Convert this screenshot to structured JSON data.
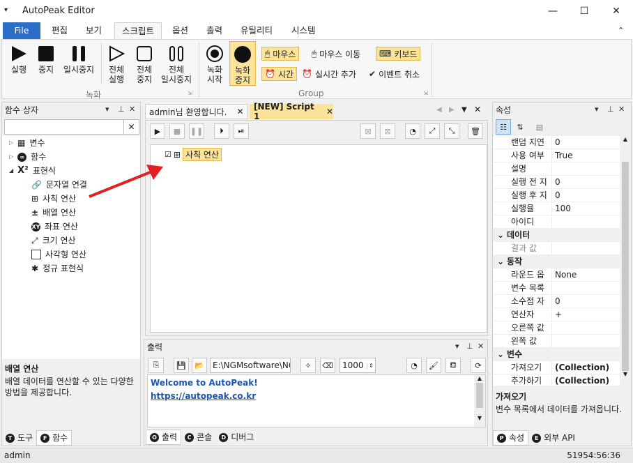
{
  "window": {
    "title": "AutoPeak Editor",
    "minimize": "—",
    "maximize": "☐",
    "close": "✕"
  },
  "ribbon_tabs": [
    "File",
    "편집",
    "보기",
    "스크립트",
    "옵션",
    "출력",
    "유틸리티",
    "시스템"
  ],
  "ribbon": {
    "run": "실행",
    "stop": "중지",
    "pause": "일시중지",
    "all_run": [
      "전체",
      "실행"
    ],
    "all_stop": [
      "전체",
      "중지"
    ],
    "all_pause": [
      "전체",
      "일시중지"
    ],
    "group1_label": "녹화",
    "rec_start": [
      "녹화",
      "시작"
    ],
    "rec_stop": [
      "녹화",
      "중지"
    ],
    "mouse": "마우스",
    "mouse_move": "마우스 이동",
    "keyboard": "키보드",
    "time": "시간",
    "realtime_add": "실시간 추가",
    "event_cancel": "이벤트 취소",
    "group2_label": "Group"
  },
  "func_panel": {
    "title": "함수 상자",
    "search_placeholder": "",
    "tree": [
      {
        "label": "변수",
        "icon": "variable-icon"
      },
      {
        "label": "함수",
        "icon": "function-icon"
      },
      {
        "label": "표현식",
        "icon": "expression-icon"
      }
    ],
    "children": [
      {
        "label": "문자열 연결",
        "icon": "link-icon"
      },
      {
        "label": "사칙 연산",
        "icon": "arithmetic-icon"
      },
      {
        "label": "배열 연산",
        "icon": "plusminus-icon"
      },
      {
        "label": "좌표 연산",
        "icon": "xy-icon"
      },
      {
        "label": "크기 연산",
        "icon": "resize-icon"
      },
      {
        "label": "사각형 연산",
        "icon": "rectangle-icon"
      },
      {
        "label": "정규 표현식",
        "icon": "asterisk-icon"
      }
    ],
    "desc_title": "배열 연산",
    "desc_text": "배열 데이터를 연산할 수 있는 다양한 방법을 제공합니다.",
    "tabs": [
      "도구",
      "함수"
    ]
  },
  "editor": {
    "tabs": [
      "admin님 환영합니다.",
      "[NEW] Script 1"
    ],
    "node_label": "사칙 연산"
  },
  "output": {
    "title": "출력",
    "path": "E:\\NGMsoftware\\NG",
    "number": "1000",
    "lines": [
      "Welcome to AutoPeak!",
      "https://autopeak.co.kr"
    ],
    "tabs": [
      "출력",
      "콘솔",
      "디버그"
    ]
  },
  "props": {
    "title": "속성",
    "rows": [
      {
        "k": "랜덤 지연",
        "v": "0"
      },
      {
        "k": "사용 여부",
        "v": "True"
      },
      {
        "k": "설명",
        "v": ""
      },
      {
        "k": "실행 전 지",
        "v": "0"
      },
      {
        "k": "실행 후 지",
        "v": "0"
      },
      {
        "k": "실행율",
        "v": "100"
      },
      {
        "k": "아이디",
        "v": ""
      }
    ],
    "cat_data": "데이터",
    "data_rows": [
      {
        "k": "결과 값",
        "v": ""
      }
    ],
    "cat_action": "동작",
    "action_rows": [
      {
        "k": "라운드 옵",
        "v": "None"
      },
      {
        "k": "변수 목록",
        "v": ""
      },
      {
        "k": "소수점 자",
        "v": "0"
      },
      {
        "k": "연산자",
        "v": "+"
      },
      {
        "k": "오른쪽 값",
        "v": ""
      },
      {
        "k": "왼쪽 값",
        "v": ""
      }
    ],
    "cat_var": "변수",
    "var_rows": [
      {
        "k": "가져오기",
        "v": "(Collection)"
      },
      {
        "k": "추가하기",
        "v": "(Collection)"
      }
    ],
    "desc_title": "가져오기",
    "desc_text": "변수 목록에서 데이터를 가져옵니다.",
    "tabs": [
      "속성",
      "외부 API"
    ]
  },
  "status": {
    "user": "admin",
    "time": "51954:56:36"
  },
  "colors": {
    "accent": "#2b6cc4",
    "highlight": "#fbe39a",
    "link": "#1a56b0",
    "arrow": "#e02020"
  }
}
